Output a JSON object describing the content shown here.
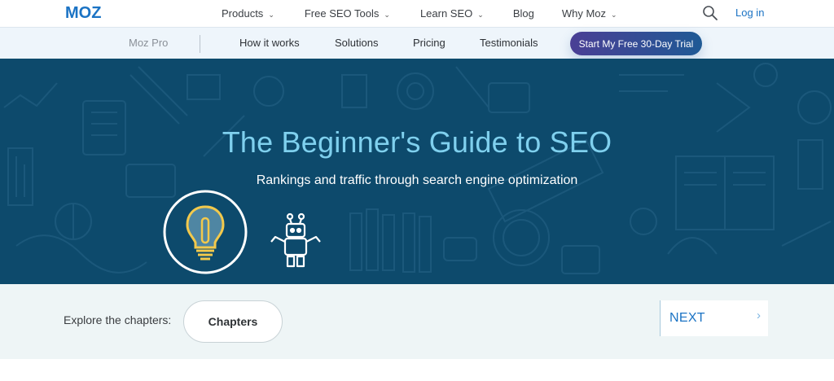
{
  "brand": {
    "logo_text": "MOZ",
    "color": "#1b73c4"
  },
  "topnav": {
    "items": [
      {
        "label": "Products",
        "has_dropdown": true
      },
      {
        "label": "Free SEO Tools",
        "has_dropdown": true
      },
      {
        "label": "Learn SEO",
        "has_dropdown": true
      },
      {
        "label": "Blog",
        "has_dropdown": false
      },
      {
        "label": "Why Moz",
        "has_dropdown": true
      }
    ],
    "chevron": "⌄",
    "search_icon": "search-icon",
    "login_label": "Log in"
  },
  "subnav": {
    "brand_label": "Moz Pro",
    "links": [
      "How it works",
      "Solutions",
      "Pricing",
      "Testimonials"
    ],
    "cta_label": "Start My Free 30-Day Trial"
  },
  "hero": {
    "title": "The Beginner's Guide to SEO",
    "subtitle": "Rankings and traffic through search engine optimization",
    "background_color": "#0d4a6c",
    "title_color": "#7fd0ee",
    "icons": [
      "lightbulb-icon",
      "robot-icon"
    ]
  },
  "chapters": {
    "explore_label": "Explore the chapters:",
    "chapters_button_label": "Chapters",
    "next_label": "NEXT",
    "next_chevron": "›"
  }
}
